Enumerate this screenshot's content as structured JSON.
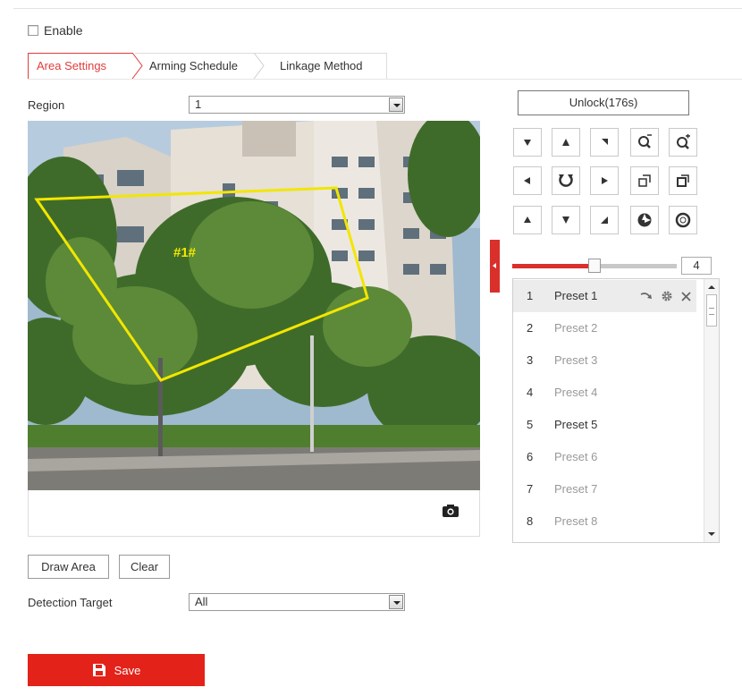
{
  "enable": {
    "label": "Enable",
    "checked": false
  },
  "tabs": [
    {
      "label": "Area Settings",
      "active": true
    },
    {
      "label": "Arming Schedule",
      "active": false
    },
    {
      "label": "Linkage Method",
      "active": false
    }
  ],
  "region": {
    "label": "Region",
    "value": "1"
  },
  "video": {
    "region_tag": "#1#",
    "snapshot_icon": "camera-icon",
    "polygon_color": "#f2e600"
  },
  "buttons": {
    "draw_area": "Draw Area",
    "clear": "Clear",
    "save": "Save",
    "save_icon": "floppy-disk-icon"
  },
  "detection_target": {
    "label": "Detection Target",
    "value": "All"
  },
  "ptz": {
    "unlock_label": "Unlock(176s)",
    "speed": "4",
    "speed_level": 0.5,
    "icons": [
      "up-left-arrow",
      "up-arrow",
      "up-right-arrow",
      "zoom-out-icon",
      "zoom-in-icon",
      "left-arrow",
      "auto-pan-icon",
      "right-arrow",
      "focus-near-icon",
      "focus-far-icon",
      "down-left-arrow",
      "down-arrow",
      "down-right-arrow",
      "iris-open-icon",
      "iris-close-icon"
    ]
  },
  "presets": [
    {
      "num": "1",
      "name": "Preset 1",
      "defined": true,
      "selected": true
    },
    {
      "num": "2",
      "name": "Preset 2",
      "defined": false
    },
    {
      "num": "3",
      "name": "Preset 3",
      "defined": false
    },
    {
      "num": "4",
      "name": "Preset 4",
      "defined": false
    },
    {
      "num": "5",
      "name": "Preset 5",
      "defined": true
    },
    {
      "num": "6",
      "name": "Preset 6",
      "defined": false
    },
    {
      "num": "7",
      "name": "Preset 7",
      "defined": false
    },
    {
      "num": "8",
      "name": "Preset 8",
      "defined": false
    }
  ],
  "colors": {
    "accent": "#e32219",
    "defined_text": "#333333",
    "undefined_text": "#999999"
  }
}
